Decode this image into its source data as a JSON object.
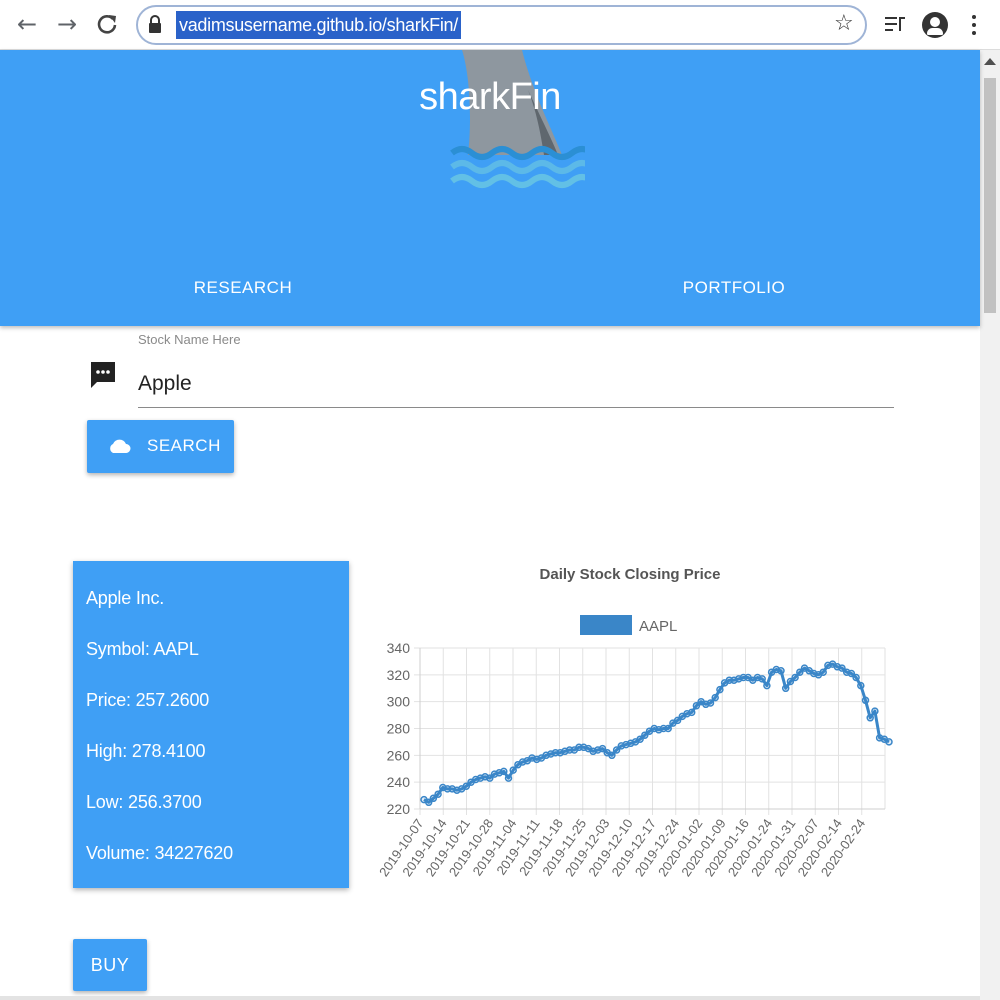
{
  "browser": {
    "url": "vadimsusername.github.io/sharkFin/",
    "back_icon": "arrow-left-icon",
    "forward_icon": "arrow-right-icon",
    "reload_icon": "reload-icon",
    "lock_icon": "lock-icon",
    "bookmark_icon": "star-icon",
    "queue_icon": "media-queue-icon",
    "account_icon": "account-icon",
    "menu_icon": "kebab-menu-icon"
  },
  "header": {
    "title": "sharkFin",
    "logo_icon": "shark-fin-logo-icon",
    "tabs": [
      {
        "label": "RESEARCH"
      },
      {
        "label": "PORTFOLIO"
      }
    ]
  },
  "search": {
    "label": "Stock Name Here",
    "value": "Apple",
    "input_icon": "chat-bubble-icon",
    "button_label": "SEARCH",
    "button_icon": "cloud-icon"
  },
  "stock_info": {
    "name": "Apple Inc.",
    "symbol": "Symbol: AAPL",
    "price": "Price: 257.2600",
    "high": "High: 278.4100",
    "low": "Low: 256.3700",
    "volume": "Volume: 34227620"
  },
  "buy_label": "BUY",
  "colors": {
    "primary": "#3f9ff5",
    "series": "#3a86c8",
    "url_highlight": "#2a62c9"
  },
  "chart_data": {
    "type": "line",
    "title": "Daily Stock Closing Price",
    "legend_position": "top",
    "grid": true,
    "ylim": [
      220,
      340
    ],
    "yticks": [
      220,
      240,
      260,
      280,
      300,
      320,
      340
    ],
    "x_tick_labels": [
      "2019-10-07",
      "2019-10-14",
      "2019-10-21",
      "2019-10-28",
      "2019-11-04",
      "2019-11-11",
      "2019-11-18",
      "2019-11-25",
      "2019-12-03",
      "2019-12-10",
      "2019-12-17",
      "2019-12-24",
      "2020-01-02",
      "2020-01-09",
      "2020-01-16",
      "2020-01-24",
      "2020-01-31",
      "2020-02-07",
      "2020-02-14",
      "2020-02-24"
    ],
    "series": [
      {
        "name": "AAPL",
        "values": [
          227,
          225,
          228,
          231,
          236,
          235,
          235,
          234,
          235,
          237,
          240,
          242,
          243,
          244,
          243,
          246,
          247,
          248,
          243,
          249,
          253,
          255,
          256,
          258,
          257,
          258,
          260,
          261,
          262,
          262,
          263,
          264,
          264,
          266,
          266,
          265,
          263,
          264,
          265,
          262,
          260,
          264,
          267,
          268,
          269,
          270,
          272,
          275,
          278,
          280,
          279,
          280,
          280,
          284,
          286,
          289,
          291,
          292,
          297,
          300,
          298,
          299,
          303,
          309,
          314,
          316,
          316,
          317,
          318,
          318,
          316,
          318,
          317,
          312,
          322,
          324,
          323,
          310,
          315,
          318,
          322,
          325,
          323,
          321,
          320,
          322,
          327,
          328,
          326,
          325,
          322,
          321,
          318,
          312,
          301,
          288,
          293,
          273,
          272,
          270
        ]
      }
    ]
  }
}
